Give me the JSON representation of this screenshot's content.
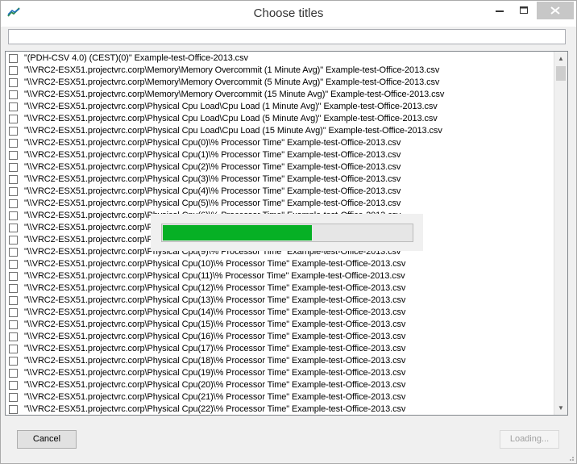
{
  "window": {
    "title": "Choose titles"
  },
  "search": {
    "value": "",
    "placeholder": ""
  },
  "list_items": [
    "\"(PDH-CSV 4.0) (CEST)(0)\" Example-test-Office-2013.csv",
    "\"\\\\VRC2-ESX51.projectvrc.corp\\Memory\\Memory Overcommit (1 Minute Avg)\" Example-test-Office-2013.csv",
    "\"\\\\VRC2-ESX51.projectvrc.corp\\Memory\\Memory Overcommit (5 Minute Avg)\" Example-test-Office-2013.csv",
    "\"\\\\VRC2-ESX51.projectvrc.corp\\Memory\\Memory Overcommit (15 Minute Avg)\" Example-test-Office-2013.csv",
    "\"\\\\VRC2-ESX51.projectvrc.corp\\Physical Cpu Load\\Cpu Load (1 Minute Avg)\" Example-test-Office-2013.csv",
    "\"\\\\VRC2-ESX51.projectvrc.corp\\Physical Cpu Load\\Cpu Load (5 Minute Avg)\" Example-test-Office-2013.csv",
    "\"\\\\VRC2-ESX51.projectvrc.corp\\Physical Cpu Load\\Cpu Load (15 Minute Avg)\" Example-test-Office-2013.csv",
    "\"\\\\VRC2-ESX51.projectvrc.corp\\Physical Cpu(0)\\% Processor Time\" Example-test-Office-2013.csv",
    "\"\\\\VRC2-ESX51.projectvrc.corp\\Physical Cpu(1)\\% Processor Time\" Example-test-Office-2013.csv",
    "\"\\\\VRC2-ESX51.projectvrc.corp\\Physical Cpu(2)\\% Processor Time\" Example-test-Office-2013.csv",
    "\"\\\\VRC2-ESX51.projectvrc.corp\\Physical Cpu(3)\\% Processor Time\" Example-test-Office-2013.csv",
    "\"\\\\VRC2-ESX51.projectvrc.corp\\Physical Cpu(4)\\% Processor Time\" Example-test-Office-2013.csv",
    "\"\\\\VRC2-ESX51.projectvrc.corp\\Physical Cpu(5)\\% Processor Time\" Example-test-Office-2013.csv",
    "\"\\\\VRC2-ESX51.projectvrc.corp\\Physical Cpu(6)\\% Processor Time\" Example-test-Office-2013.csv",
    "\"\\\\VRC2-ESX51.projectvrc.corp\\Physical Cpu(7)\\% Processor Time\" Example-test-Office-2013.csv",
    "\"\\\\VRC2-ESX51.projectvrc.corp\\Physical Cpu(8)\\% Processor Time\" Example-test-Office-2013.csv",
    "\"\\\\VRC2-ESX51.projectvrc.corp\\Physical Cpu(9)\\% Processor Time\" Example-test-Office-2013.csv",
    "\"\\\\VRC2-ESX51.projectvrc.corp\\Physical Cpu(10)\\% Processor Time\" Example-test-Office-2013.csv",
    "\"\\\\VRC2-ESX51.projectvrc.corp\\Physical Cpu(11)\\% Processor Time\" Example-test-Office-2013.csv",
    "\"\\\\VRC2-ESX51.projectvrc.corp\\Physical Cpu(12)\\% Processor Time\" Example-test-Office-2013.csv",
    "\"\\\\VRC2-ESX51.projectvrc.corp\\Physical Cpu(13)\\% Processor Time\" Example-test-Office-2013.csv",
    "\"\\\\VRC2-ESX51.projectvrc.corp\\Physical Cpu(14)\\% Processor Time\" Example-test-Office-2013.csv",
    "\"\\\\VRC2-ESX51.projectvrc.corp\\Physical Cpu(15)\\% Processor Time\" Example-test-Office-2013.csv",
    "\"\\\\VRC2-ESX51.projectvrc.corp\\Physical Cpu(16)\\% Processor Time\" Example-test-Office-2013.csv",
    "\"\\\\VRC2-ESX51.projectvrc.corp\\Physical Cpu(17)\\% Processor Time\" Example-test-Office-2013.csv",
    "\"\\\\VRC2-ESX51.projectvrc.corp\\Physical Cpu(18)\\% Processor Time\" Example-test-Office-2013.csv",
    "\"\\\\VRC2-ESX51.projectvrc.corp\\Physical Cpu(19)\\% Processor Time\" Example-test-Office-2013.csv",
    "\"\\\\VRC2-ESX51.projectvrc.corp\\Physical Cpu(20)\\% Processor Time\" Example-test-Office-2013.csv",
    "\"\\\\VRC2-ESX51.projectvrc.corp\\Physical Cpu(21)\\% Processor Time\" Example-test-Office-2013.csv",
    "\"\\\\VRC2-ESX51.projectvrc.corp\\Physical Cpu(22)\\% Processor Time\" Example-test-Office-2013.csv"
  ],
  "progress": {
    "fraction": 0.6,
    "color": "#06b025"
  },
  "buttons": {
    "cancel": "Cancel",
    "loading": "Loading..."
  },
  "icons": {
    "app": "chart-line-icon",
    "minimize": "minimize-icon",
    "maximize": "maximize-icon",
    "close": "close-icon",
    "scroll_up": "scroll-up-arrow-icon",
    "scroll_down": "scroll-down-arrow-icon"
  }
}
